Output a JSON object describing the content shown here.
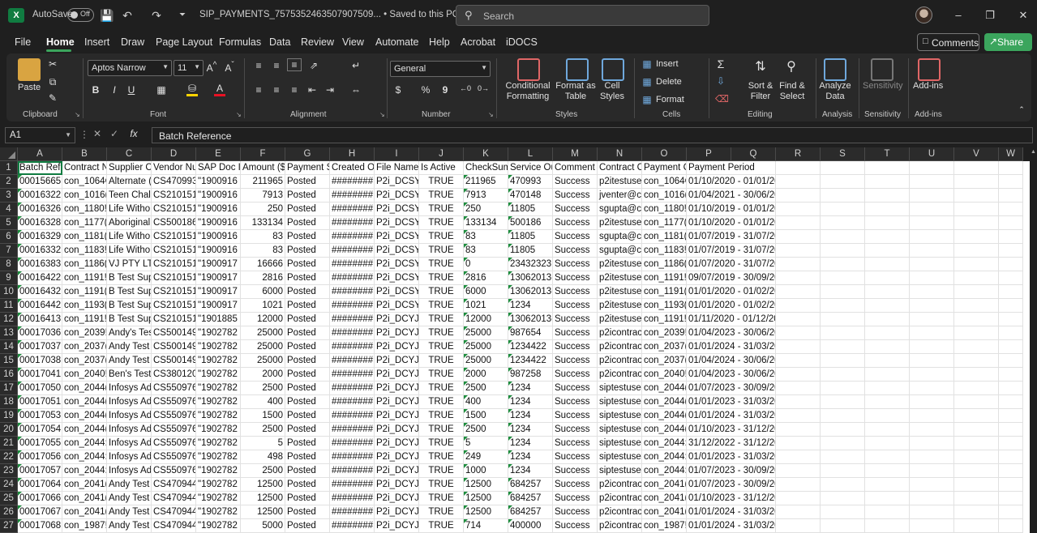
{
  "titlebar": {
    "logo": "X",
    "autosave_label": "AutoSave",
    "autosave_state": "Off",
    "file_title": "SIP_PAYMENTS_7575352463507907509... • Saved to this PC",
    "search_placeholder": "Search",
    "icons": [
      "save-icon",
      "undo-icon",
      "redo-icon",
      "customize-icon"
    ]
  },
  "menu": {
    "tabs": [
      "File",
      "Home",
      "Insert",
      "Draw",
      "Page Layout",
      "Formulas",
      "Data",
      "Review",
      "View",
      "Automate",
      "Help",
      "Acrobat",
      "iDOCS"
    ],
    "active": "Home",
    "comments": "Comments",
    "share": "Share"
  },
  "ribbon": {
    "clipboard": {
      "paste": "Paste",
      "label": "Clipboard"
    },
    "font": {
      "name": "Aptos Narrow",
      "size": "11",
      "label": "Font",
      "bold": "B",
      "italic": "I",
      "underline": "U"
    },
    "alignment": {
      "label": "Alignment"
    },
    "number": {
      "format": "General",
      "label": "Number",
      "currency": "$",
      "percent": "%",
      "comma": "9"
    },
    "styles": {
      "conditional": "Conditional Formatting",
      "format_table": "Format as Table",
      "cell_styles": "Cell Styles",
      "label": "Styles"
    },
    "cells": {
      "insert": "Insert",
      "delete": "Delete",
      "format": "Format",
      "label": "Cells"
    },
    "editing": {
      "sort": "Sort & Filter",
      "find": "Find & Select",
      "label": "Editing"
    },
    "analysis": {
      "analyze": "Analyze Data",
      "label": "Analysis"
    },
    "sensitivity": {
      "button": "Sensitivity",
      "label": "Sensitivity"
    },
    "addins": {
      "button": "Add-ins",
      "label": "Add-ins"
    },
    "colors": {
      "green": "#3ba55d",
      "highlight": "#ffd400",
      "fontcolor": "#e81123"
    }
  },
  "formula_bar": {
    "name_box": "A1",
    "fx": "fx",
    "content": "Batch Reference"
  },
  "columns": [
    "A",
    "B",
    "C",
    "D",
    "E",
    "F",
    "G",
    "H",
    "I",
    "J",
    "K",
    "L",
    "M",
    "N",
    "O",
    "P",
    "Q",
    "R",
    "S",
    "T",
    "U",
    "V",
    "W"
  ],
  "rows": [
    [
      "Batch Refe",
      "Contract N",
      "Supplier C",
      "Vendor Nu",
      "SAP Doc Ic",
      "Amount ($",
      "Payment S",
      "Created O",
      "File Name",
      "Is Active",
      "CheckSum",
      "Service Ou",
      "Comment",
      "Contract C",
      "Payment C",
      "Payment Period"
    ],
    [
      "00015665",
      "con_1064€",
      "Alternate (",
      "CS470993",
      "\"1900916 ",
      "211965",
      "Posted",
      "########",
      "P2i_DCSY\\",
      "TRUE",
      "211965",
      "470993",
      "Success",
      "p2itestuse",
      "con_1064€",
      "01/10/2020 - 01/01/2021"
    ],
    [
      "00016322",
      "con_1016(",
      "Teen Chal",
      "CS210151",
      "\"1900916 ",
      "7913",
      "Posted",
      "########",
      "P2i_DCSY\\",
      "TRUE",
      "7913",
      "470148",
      "Success",
      "jventer@c",
      "con_1016(",
      "01/04/2021 - 30/06/2021"
    ],
    [
      "00016326",
      "con_1180!",
      "Life Witho",
      "CS210151",
      "\"1900916 ",
      "250",
      "Posted",
      "########",
      "P2i_DCSY\\",
      "TRUE",
      "250",
      "11805",
      "Success",
      "sgupta@c",
      "con_1180!",
      "01/10/2019 - 01/01/2020"
    ],
    [
      "00016328",
      "con_1177(",
      "Aboriginal",
      "CS500186",
      "\"1900916 ",
      "133134",
      "Posted",
      "########",
      "P2i_DCSY\\",
      "TRUE",
      "133134",
      "500186",
      "Success",
      "p2itestuse",
      "con_1177(",
      "01/10/2020 - 01/01/2021"
    ],
    [
      "00016329",
      "con_1181(",
      "Life Witho",
      "CS210151",
      "\"1900916 ",
      "83",
      "Posted",
      "########",
      "P2i_DCSY\\",
      "TRUE",
      "83",
      "11805",
      "Success",
      "sgupta@c",
      "con_1181(",
      "01/07/2019 - 31/07/2019"
    ],
    [
      "00016332",
      "con_1183!",
      "Life Witho",
      "CS210151",
      "\"1900916 ",
      "83",
      "Posted",
      "########",
      "P2i_DCSY\\",
      "TRUE",
      "83",
      "11805",
      "Success",
      "sgupta@c",
      "con_1183!",
      "01/07/2019 - 31/07/2019"
    ],
    [
      "00016383",
      "con_1186(",
      "VJ PTY LTD",
      "CS210151",
      "\"1900917 ",
      "16666",
      "Posted",
      "########",
      "P2i_DCSY\\",
      "TRUE",
      "0",
      "23432323",
      "Success",
      "p2itestuse",
      "con_1186(",
      "01/07/2020 - 31/07/2020"
    ],
    [
      "00016422",
      "con_1191!",
      "B Test Sup",
      "CS210151",
      "\"1900917 ",
      "2816",
      "Posted",
      "########",
      "P2i_DCSY\\",
      "TRUE",
      "2816",
      "13062013(",
      "Success",
      "p2itestuse",
      "con_1191!",
      "09/07/2019 - 30/09/2019"
    ],
    [
      "00016432",
      "con_1191(",
      "B Test Sup",
      "CS210151",
      "\"1900917 ",
      "6000",
      "Posted",
      "########",
      "P2i_DCSY\\",
      "TRUE",
      "6000",
      "13062013(",
      "Success",
      "p2itestuse",
      "con_1191(",
      "01/01/2020 - 01/02/2020"
    ],
    [
      "00016442",
      "con_1193(",
      "B Test Sup",
      "CS210151",
      "\"1900917 ",
      "1021",
      "Posted",
      "########",
      "P2i_DCSY\\",
      "TRUE",
      "1021",
      "1234",
      "Success",
      "p2itestuse",
      "con_1193(",
      "01/01/2020 - 01/02/2020"
    ],
    [
      "00016413",
      "con_1191!",
      "B Test Sup",
      "CS210151",
      "\"1901885 ",
      "12000",
      "Posted",
      "########",
      "P2i_DCYJI",
      "TRUE",
      "12000",
      "13062013(",
      "Success",
      "p2itestuse",
      "con_1191!",
      "01/11/2020 - 01/12/2020"
    ],
    [
      "00017036",
      "con_2039!",
      "Andy's Tes",
      "CS500149",
      "\"1902782 ",
      "25000",
      "Posted",
      "########",
      "P2i_DCYJI",
      "TRUE",
      "25000",
      "987654",
      "Success",
      "p2icontrac",
      "con_2039!",
      "01/04/2023 - 30/06/2023"
    ],
    [
      "00017037",
      "con_2037(",
      "Andy Test (",
      "CS500149",
      "\"1902782 ",
      "25000",
      "Posted",
      "########",
      "P2i_DCYJI",
      "TRUE",
      "25000",
      "1234422",
      "Success",
      "p2icontrac",
      "con_2037(",
      "01/01/2024 - 31/03/2024"
    ],
    [
      "00017038",
      "con_2037(",
      "Andy Test (",
      "CS500149",
      "\"1902782 ",
      "25000",
      "Posted",
      "########",
      "P2i_DCYJI",
      "TRUE",
      "25000",
      "1234422",
      "Success",
      "p2icontrac",
      "con_2037(",
      "01/04/2024 - 30/06/2024"
    ],
    [
      "00017041",
      "con_2040!",
      "Ben's Test",
      "CS380120",
      "\"1902782 ",
      "2000",
      "Posted",
      "########",
      "P2i_DCYJI",
      "TRUE",
      "2000",
      "987258",
      "Success",
      "p2icontrac",
      "con_2040!",
      "01/04/2023 - 30/06/2023"
    ],
    [
      "00017050",
      "con_2044(",
      "Infosys Ad",
      "CS550976",
      "\"1902782 ",
      "2500",
      "Posted",
      "########",
      "P2i_DCYJI",
      "TRUE",
      "2500",
      "1234",
      "Success",
      "siptestuse",
      "con_2044(",
      "01/07/2023 - 30/09/2023"
    ],
    [
      "00017051",
      "con_2044(",
      "Infosys Ad",
      "CS550976",
      "\"1902782 ",
      "400",
      "Posted",
      "########",
      "P2i_DCYJI",
      "TRUE",
      "400",
      "1234",
      "Success",
      "siptestuse",
      "con_2044(",
      "01/01/2023 - 31/03/2023"
    ],
    [
      "00017053",
      "con_2044(",
      "Infosys Ad",
      "CS550976",
      "\"1902782 ",
      "1500",
      "Posted",
      "########",
      "P2i_DCYJI",
      "TRUE",
      "1500",
      "1234",
      "Success",
      "siptestuse",
      "con_2044(",
      "01/01/2024 - 31/03/2024"
    ],
    [
      "00017054",
      "con_2044(",
      "Infosys Ad",
      "CS550976",
      "\"1902782 ",
      "2500",
      "Posted",
      "########",
      "P2i_DCYJI",
      "TRUE",
      "2500",
      "1234",
      "Success",
      "siptestuse",
      "con_2044(",
      "01/10/2023 - 31/12/2023"
    ],
    [
      "00017055",
      "con_2044:",
      "Infosys Ad",
      "CS550976",
      "\"1902782 ",
      "5",
      "Posted",
      "########",
      "P2i_DCYJI",
      "TRUE",
      "5",
      "1234",
      "Success",
      "siptestuse",
      "con_2044:",
      "31/12/2022 - 31/12/2022"
    ],
    [
      "00017056",
      "con_2044:",
      "Infosys Ad",
      "CS550976",
      "\"1902782 ",
      "498",
      "Posted",
      "########",
      "P2i_DCYJI",
      "TRUE",
      "249",
      "1234",
      "Success",
      "siptestuse",
      "con_2044:",
      "01/01/2023 - 31/03/2023"
    ],
    [
      "00017057",
      "con_2044:",
      "Infosys Ad",
      "CS550976",
      "\"1902782 ",
      "2500",
      "Posted",
      "########",
      "P2i_DCYJI",
      "TRUE",
      "1000",
      "1234",
      "Success",
      "siptestuse",
      "con_2044:",
      "01/07/2023 - 30/09/2023"
    ],
    [
      "00017064",
      "con_2041(",
      "Andy Test (",
      "CS470944",
      "\"1902782 ",
      "12500",
      "Posted",
      "########",
      "P2i_DCYJI",
      "TRUE",
      "12500",
      "684257",
      "Success",
      "p2icontrac",
      "con_2041(",
      "01/07/2023 - 30/09/2023"
    ],
    [
      "00017066",
      "con_2041(",
      "Andy Test (",
      "CS470944",
      "\"1902782 ",
      "12500",
      "Posted",
      "########",
      "P2i_DCYJI",
      "TRUE",
      "12500",
      "684257",
      "Success",
      "p2icontrac",
      "con_2041(",
      "01/10/2023 - 31/12/2023"
    ],
    [
      "00017067",
      "con_2041(",
      "Andy Test (",
      "CS470944",
      "\"1902782 ",
      "12500",
      "Posted",
      "########",
      "P2i_DCYJI",
      "TRUE",
      "12500",
      "684257",
      "Success",
      "p2icontrac",
      "con_2041(",
      "01/01/2024 - 31/03/2024"
    ],
    [
      "00017068",
      "con_1987!",
      "Andy Test (",
      "CS470944",
      "\"1902782 ",
      "5000",
      "Posted",
      "########",
      "P2i_DCYJI",
      "TRUE",
      "714",
      "400000",
      "Success",
      "p2icontrac",
      "con_1987!",
      "01/01/2024 - 31/03/2024"
    ]
  ]
}
